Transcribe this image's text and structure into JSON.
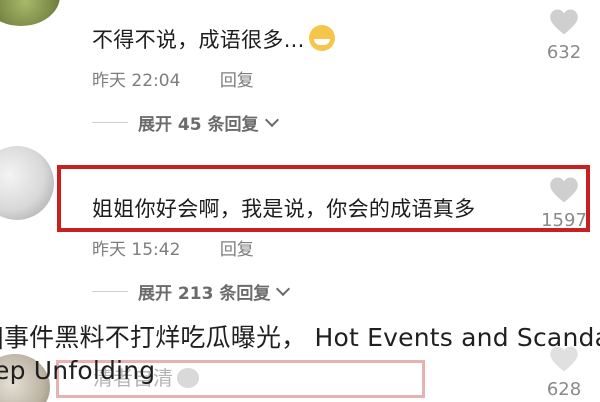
{
  "comments": [
    {
      "text": "不得不说，成语很多...",
      "emoji": "grinning-sweat-emoji",
      "time": "昨天 22:04",
      "reply_label": "回复",
      "likes": "632",
      "expand_label": "展开 45 条回复"
    },
    {
      "text": "姐姐你好会啊，我是说，你会的成语真多",
      "time": "昨天 15:42",
      "reply_label": "回复",
      "likes": "1597",
      "expand_label": "展开 213 条回复"
    },
    {
      "text": "清者自清",
      "emoji": "cat-emoji",
      "likes": "628"
    }
  ],
  "watermark": {
    "line1": "]事件黑料不打烊吃瓜曝光，  Hot Events and Scandal",
    "line2": "ep Unfolding"
  },
  "colors": {
    "highlight": "#c8201e",
    "faded_highlight": "#e8b2b2",
    "meta_text": "#7d7d7d"
  }
}
